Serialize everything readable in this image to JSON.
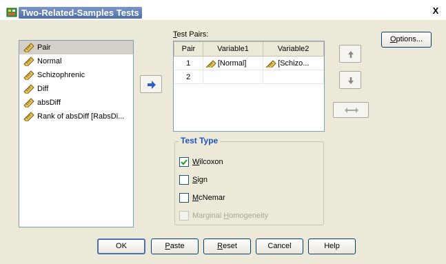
{
  "window": {
    "title": "Two-Related-Samples Tests",
    "close_glyph": "X"
  },
  "options_button": {
    "prefix": "",
    "mnemonic": "O",
    "suffix": "ptions..."
  },
  "variable_list": [
    {
      "label": "Pair",
      "selected": true
    },
    {
      "label": "Normal",
      "selected": false
    },
    {
      "label": "Schizophrenic",
      "selected": false
    },
    {
      "label": "Diff",
      "selected": false
    },
    {
      "label": "absDiff",
      "selected": false
    },
    {
      "label": "Rank of absDiff [RabsDi...",
      "selected": false
    }
  ],
  "test_pairs": {
    "label_mnemonic": "T",
    "label_rest": "est Pairs:",
    "columns": [
      "Pair",
      "Variable1",
      "Variable2"
    ],
    "rows": [
      {
        "pair": "1",
        "variable1": "[Normal]",
        "variable2": "[Schizo..."
      },
      {
        "pair": "2",
        "variable1": "",
        "variable2": ""
      }
    ]
  },
  "test_type": {
    "title": "Test Type",
    "options": [
      {
        "mnemonic": "W",
        "rest": "ilcoxon",
        "checked": true,
        "enabled": true
      },
      {
        "mnemonic": "S",
        "rest": "ign",
        "checked": false,
        "enabled": true
      },
      {
        "mnemonic": "M",
        "rest": "cNemar",
        "checked": false,
        "enabled": true
      },
      {
        "prefix": "Marginal ",
        "mnemonic": "H",
        "rest": "omogeneity",
        "checked": false,
        "enabled": false
      }
    ]
  },
  "buttons": {
    "ok": "OK",
    "paste": {
      "mnemonic": "P",
      "rest": "aste"
    },
    "reset": {
      "mnemonic": "R",
      "rest": "eset"
    },
    "cancel": "Cancel",
    "help": "Help"
  },
  "colors": {
    "accent_blue": "#2152c4",
    "move_arrow": "#2b5fc4"
  },
  "icons": {
    "title": "spss-dialog-icon",
    "variable": "ruler-scale-icon",
    "move": "arrow-right-icon",
    "up": "arrow-up-icon",
    "down": "arrow-down-icon",
    "swap": "swap-horizontal-icon"
  }
}
